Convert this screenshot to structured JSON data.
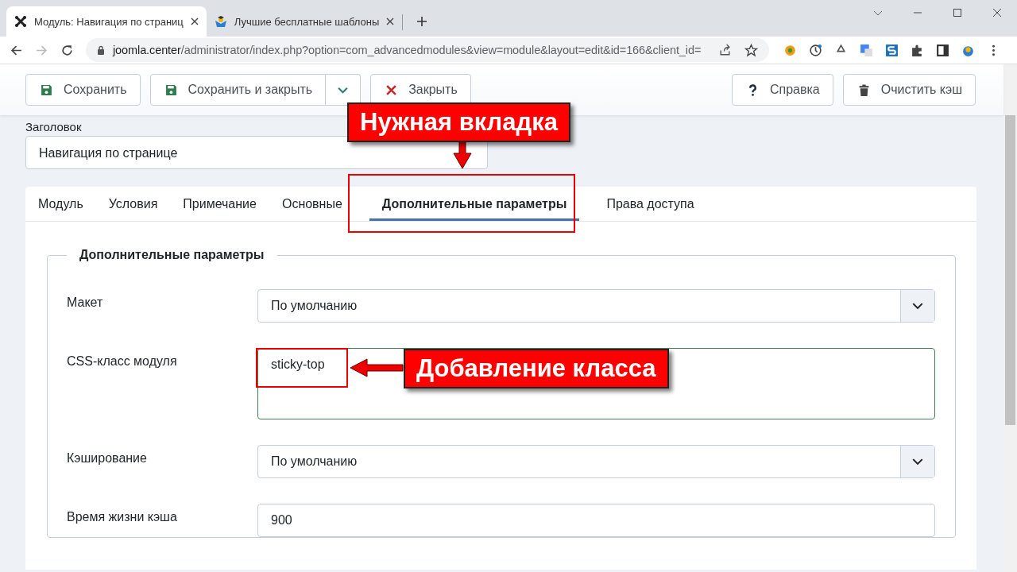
{
  "browser": {
    "tabs": [
      {
        "title": "Модуль: Навигация по страниц",
        "selected": true
      },
      {
        "title": "Лучшие бесплатные шаблоны",
        "selected": false
      }
    ],
    "url_host": "joomla.center",
    "url_path": "/administrator/index.php?option=com_advancedmodules&view=module&layout=edit&id=166&client_id="
  },
  "toolbar": {
    "left": [
      {
        "label": "Сохранить",
        "dropdown": false
      },
      {
        "label": "Сохранить и закрыть",
        "dropdown": true
      },
      {
        "label": "Закрыть",
        "dropdown": false
      }
    ],
    "right": [
      {
        "label": "Справка"
      },
      {
        "label": "Очистить кэш"
      }
    ]
  },
  "title_field": {
    "label": "Заголовок",
    "value": "Навигация по странице"
  },
  "tabs": [
    {
      "label": "Модуль",
      "selected": false
    },
    {
      "label": "Условия",
      "selected": false
    },
    {
      "label": "Примечание",
      "selected": false
    },
    {
      "label": "Основные",
      "selected": false
    },
    {
      "label": "Дополнительные параметры",
      "selected": true
    },
    {
      "label": "Права доступа",
      "selected": false
    }
  ],
  "fieldset": {
    "legend": "Дополнительные параметры",
    "fields": [
      {
        "label": "Макет",
        "kind": "select",
        "value": "По умолчанию"
      },
      {
        "label": "CSS-класс модуля",
        "kind": "textarea",
        "value": "sticky-top"
      },
      {
        "label": "Кэширование",
        "kind": "select",
        "value": "По умолчанию"
      },
      {
        "label": "Время жизни кэша",
        "kind": "text",
        "value": "900"
      }
    ]
  },
  "annotations": [
    {
      "text": "Нужная вкладка"
    },
    {
      "text": "Добавление класса"
    }
  ]
}
